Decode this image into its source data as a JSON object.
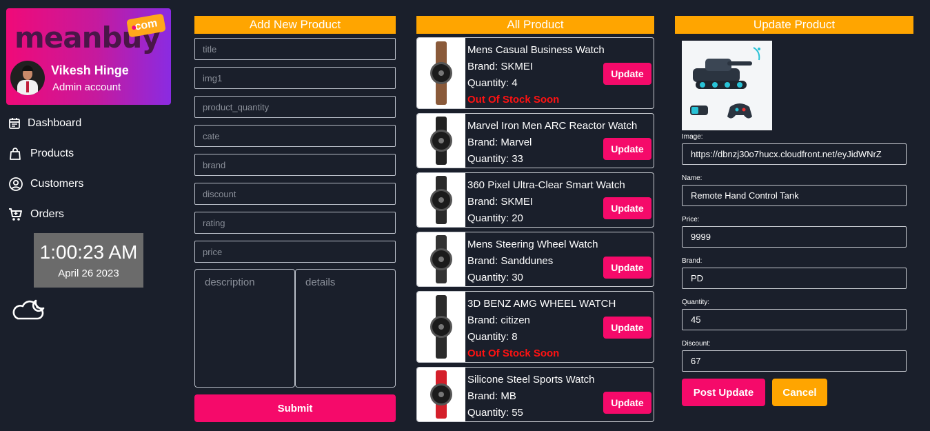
{
  "sidebar": {
    "logo_text": "meanbuy",
    "logo_tag": "com",
    "admin_name": "Vikesh Hinge",
    "admin_role": "Admin account",
    "nav": [
      {
        "label": "Dashboard",
        "icon": "calendar-icon"
      },
      {
        "label": "Products",
        "icon": "shopping-bag-icon"
      },
      {
        "label": "Customers",
        "icon": "user-circle-icon"
      },
      {
        "label": "Orders",
        "icon": "cart-icon"
      }
    ],
    "clock": {
      "time": "1:00:23 AM",
      "date": "April 26 2023"
    },
    "weather_icon": "cloud-moon-icon"
  },
  "add_product": {
    "header": "Add New Product",
    "fields": {
      "title": "title",
      "img1": "img1",
      "product_quantity": "product_quantity",
      "cate": "cate",
      "brand": "brand",
      "discount": "discount",
      "rating": "rating",
      "price": "price",
      "description": "description",
      "details": "details"
    },
    "submit_label": "Submit"
  },
  "product_list": {
    "header": "All Product",
    "update_label": "Update",
    "brand_prefix": "Brand: ",
    "quantity_prefix": "Quantity: ",
    "items": [
      {
        "title": "Mens Casual Business Watch",
        "brand": "SKMEI",
        "quantity": "4",
        "warning": "Out Of Stock Soon",
        "strap_color": "#8a5a3a"
      },
      {
        "title": "Marvel Iron Men ARC Reactor Watch",
        "brand": "Marvel",
        "quantity": "33",
        "warning": "",
        "strap_color": "#222222"
      },
      {
        "title": "360 Pixel Ultra-Clear Smart Watch",
        "brand": "SKMEI",
        "quantity": "20",
        "warning": "",
        "strap_color": "#2a2a2a"
      },
      {
        "title": "Mens Steering Wheel Watch",
        "brand": "Sanddunes",
        "quantity": "30",
        "warning": "",
        "strap_color": "#333333"
      },
      {
        "title": "3D BENZ AMG WHEEL WATCH",
        "brand": "citizen",
        "quantity": "8",
        "warning": "Out Of Stock Soon",
        "strap_color": "#2b2b2b"
      },
      {
        "title": "Silicone Steel Sports Watch",
        "brand": "MB",
        "quantity": "55",
        "warning": "",
        "strap_color": "#d41f2a"
      }
    ]
  },
  "update_product": {
    "header": "Update Product",
    "image_label": "Image:",
    "image_value": "https://dbnzj30o7hucx.cloudfront.net/eyJidWNrZ",
    "name_label": "Name:",
    "name_value": "Remote Hand Control Tank",
    "price_label": "Price:",
    "price_value": "9999",
    "brand_label": "Brand:",
    "brand_value": "PD",
    "quantity_label": "Quantity:",
    "quantity_value": "45",
    "discount_label": "Discount:",
    "discount_value": "67",
    "post_label": "Post Update",
    "cancel_label": "Cancel"
  },
  "colors": {
    "background": "#1a1f2b",
    "accent_orange": "#ffa500",
    "accent_pink": "#f50a6a",
    "warning_red": "#ff1212"
  }
}
